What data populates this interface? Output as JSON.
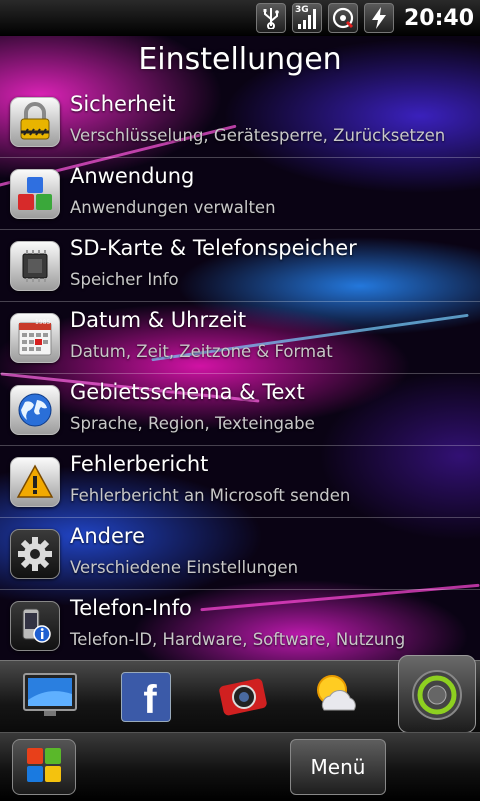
{
  "status": {
    "time": "20:40",
    "network_label": "3G",
    "icons": [
      "usb-icon",
      "signal-3g-icon",
      "sync-icon",
      "battery-charging-icon"
    ]
  },
  "header": {
    "title": "Einstellungen"
  },
  "settings": [
    {
      "label": "Sicherheit",
      "sub": "Verschlüsselung, Gerätesperre, Zurücksetzen",
      "icon": "padlock-icon"
    },
    {
      "label": "Anwendung",
      "sub": "Anwendungen verwalten",
      "icon": "app-cubes-icon"
    },
    {
      "label": "SD-Karte & Telefonspeicher",
      "sub": "Speicher Info",
      "icon": "memory-chip-icon"
    },
    {
      "label": "Datum & Uhrzeit",
      "sub": "Datum, Zeit, Zeitzone & Format",
      "icon": "calendar-icon"
    },
    {
      "label": "Gebietsschema & Text",
      "sub": "Sprache, Region, Texteingabe",
      "icon": "globe-icon"
    },
    {
      "label": "Fehlerbericht",
      "sub": "Fehlerbericht an Microsoft senden",
      "icon": "warning-icon"
    },
    {
      "label": "Andere",
      "sub": "Verschiedene Einstellungen",
      "icon": "gear-icon"
    },
    {
      "label": "Telefon-Info",
      "sub": "Telefon-ID, Hardware, Software, Nutzung",
      "icon": "phone-info-icon"
    }
  ],
  "calendar_icon_year": "1985",
  "dock": {
    "items": [
      "tv-icon",
      "facebook-icon",
      "camera-icon",
      "weather-icon",
      "settings-gear-icon"
    ],
    "facebook_letter": "f",
    "selected": "settings-gear-icon"
  },
  "bottombar": {
    "menu_label": "Menü"
  },
  "colors": {
    "wallpaper_pink": "#e614b4",
    "wallpaper_blue": "#288cff",
    "divider": "#ffffff40"
  }
}
